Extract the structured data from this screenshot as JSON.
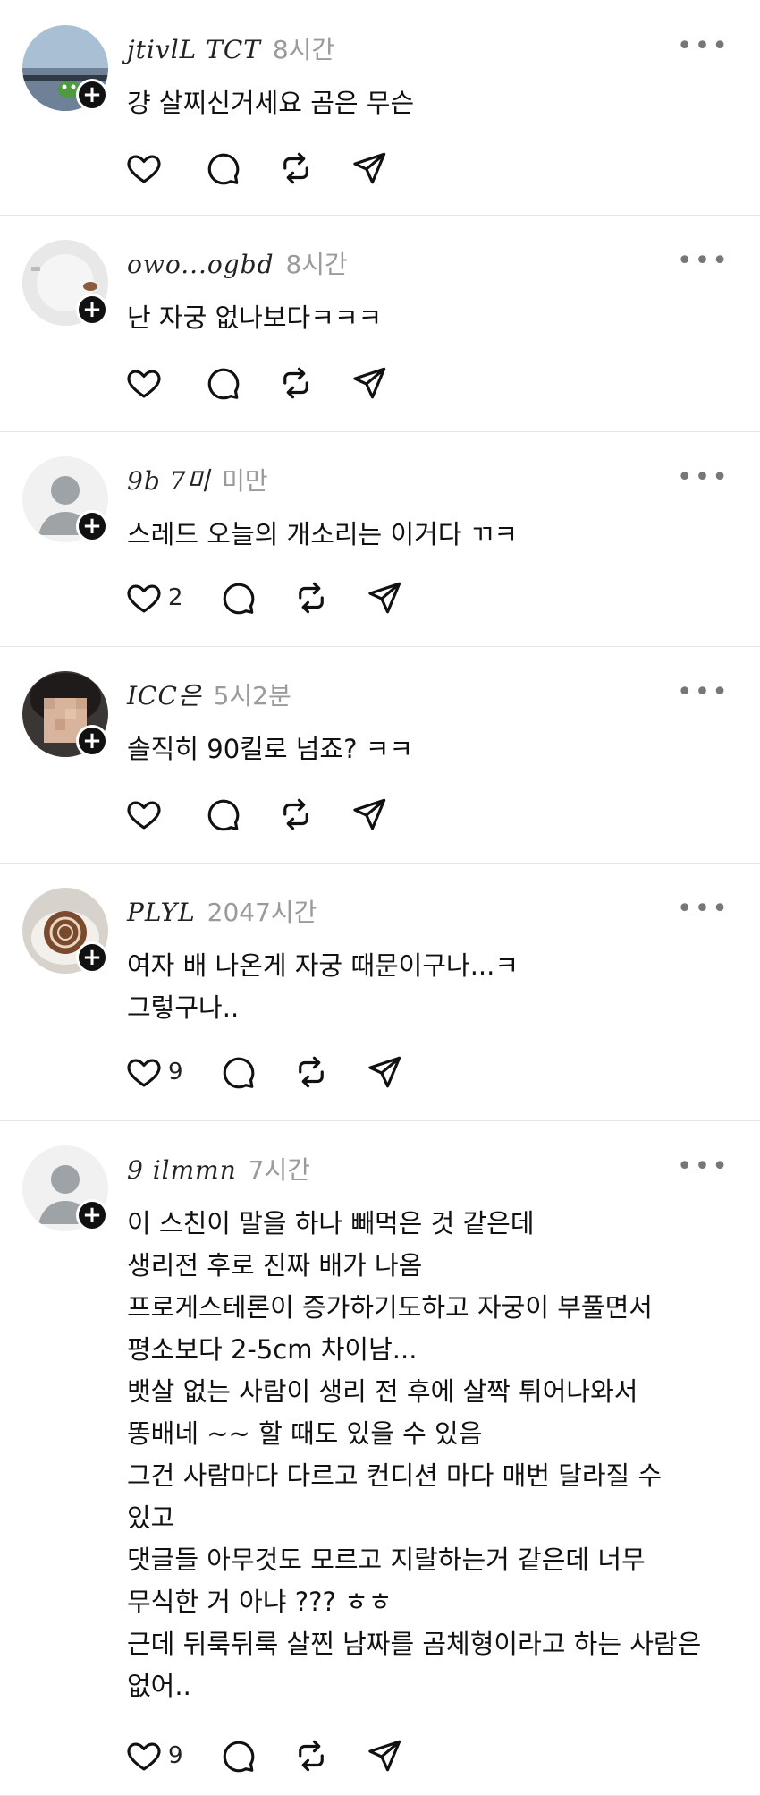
{
  "posts": [
    {
      "username": "jtivlL TCT",
      "time": "8시간",
      "text": [
        "걍 살찌신거세요 곰은 무슨"
      ],
      "likes": "",
      "more": "•••",
      "avatar": "photo-landscape"
    },
    {
      "username": "owo...ogbd",
      "time": "8시간",
      "text": [
        "난 자궁 없나보다ㅋㅋㅋ"
      ],
      "likes": "",
      "more": "•••",
      "avatar": "photo-light"
    },
    {
      "username": "9b 7미",
      "time": "미만",
      "text": [
        "스레드 오늘의 개소리는 이거다 ㄲㅋ"
      ],
      "likes": "2",
      "more": "•••",
      "avatar": "default-person"
    },
    {
      "username": "ICC은",
      "time": "5시2분",
      "text": [
        "솔직히 90킬로 넘죠? ㅋㅋ"
      ],
      "likes": "",
      "more": "•••",
      "avatar": "photo-blurred-face"
    },
    {
      "username": "PLYL",
      "time": "2047시간",
      "text": [
        "여자 배 나온게 자궁 때문이구나...ㅋ",
        "그렇구나.."
      ],
      "likes": "9",
      "more": "•••",
      "avatar": "photo-coffee"
    },
    {
      "username": "9 ilmmn",
      "time": "7시간",
      "text": [
        "이 스친이 말을 하나 빼먹은 것 같은데",
        "생리전 후로 진짜 배가 나옴",
        "프로게스테론이 증가하기도하고 자궁이 부풀면서",
        "평소보다 2-5cm 차이남...",
        "뱃살 없는 사람이 생리 전 후에 살짝 튀어나와서",
        "똥배네 ~~ 할 때도 있을 수 있음",
        "그건 사람마다 다르고 컨디션 마다 매번 달라질 수",
        "있고",
        "댓글들 아무것도 모르고 지랄하는거 같은데 너무",
        "무식한 거 아냐 ??? ㅎㅎ",
        "근데 뒤룩뒤룩 살찐 남짜를 곰체형이라고 하는 사람은",
        "없어.."
      ],
      "likes": "9",
      "more": "•••",
      "avatar": "default-person"
    }
  ],
  "icons": [
    "heart-icon",
    "comment-icon",
    "repost-icon",
    "share-icon",
    "plus-icon",
    "more-icon"
  ]
}
